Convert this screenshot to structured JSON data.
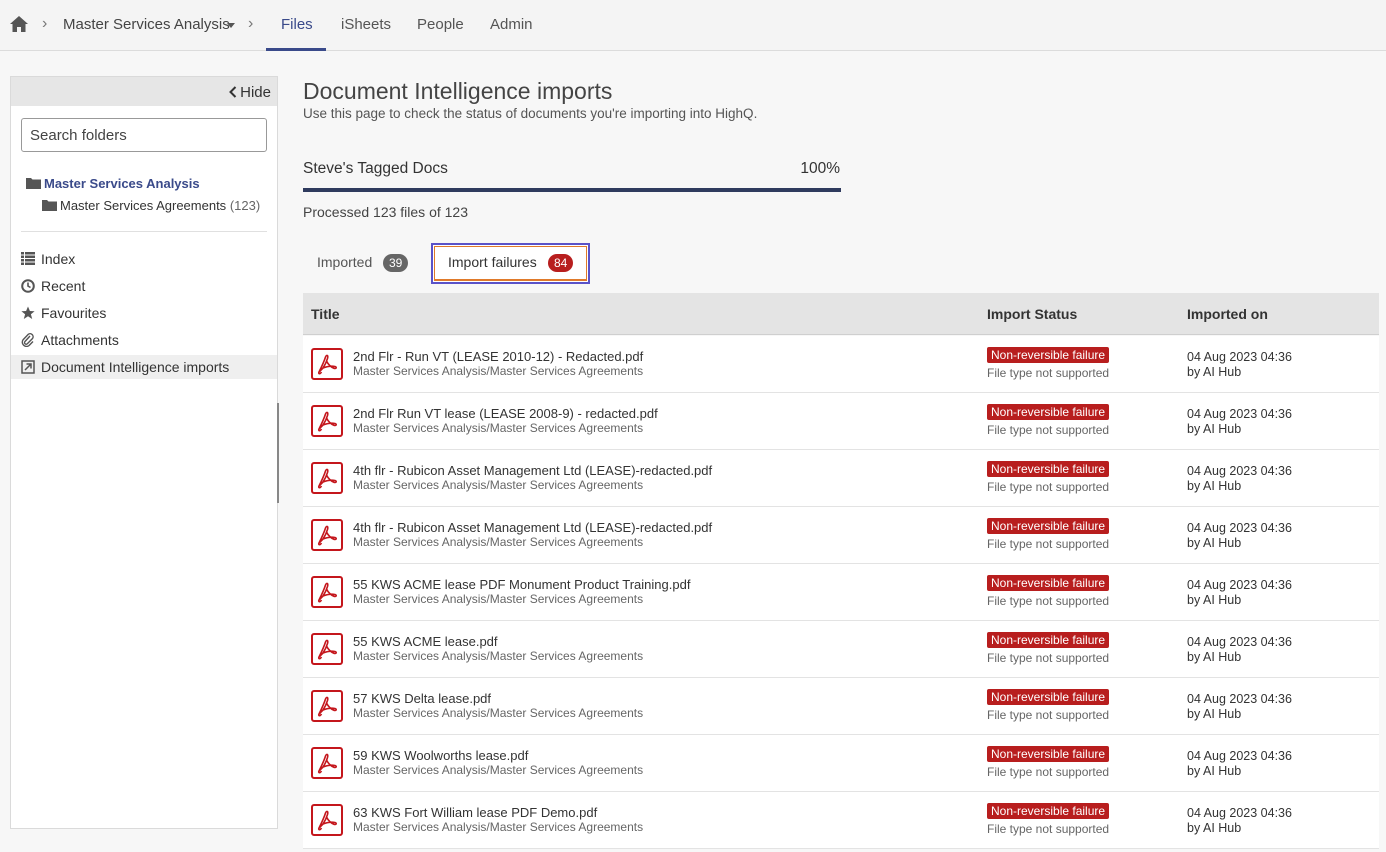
{
  "nav": {
    "breadcrumb": "Master Services Analysis",
    "tabs": [
      {
        "label": "Files",
        "active": true
      },
      {
        "label": "iSheets",
        "active": false
      },
      {
        "label": "People",
        "active": false
      },
      {
        "label": "Admin",
        "active": false
      }
    ],
    "accent": "#3a4a8a"
  },
  "sidebar": {
    "hide_label": "Hide",
    "search_placeholder": "Search folders",
    "folders": [
      {
        "label": "Master Services Analysis",
        "icon": "folder-icon"
      },
      {
        "label": "Master Services Agreements",
        "count": "(123)",
        "icon": "folder-icon"
      }
    ],
    "items": [
      {
        "label": "Index",
        "icon": "list-icon"
      },
      {
        "label": "Recent",
        "icon": "clock-icon"
      },
      {
        "label": "Favourites",
        "icon": "star-icon"
      },
      {
        "label": "Attachments",
        "icon": "paperclip-icon"
      },
      {
        "label": "Document Intelligence imports",
        "icon": "import-icon",
        "active": true
      }
    ]
  },
  "main": {
    "title": "Document Intelligence imports",
    "subtitle": "Use this page to check the status of documents you're importing into HighQ.",
    "job": {
      "name": "Steve's Tagged Docs",
      "percent_label": "100%",
      "progress": 1.0,
      "processed": "Processed 123 files of 123"
    },
    "filter_tabs": [
      {
        "label": "Imported",
        "count": "39"
      },
      {
        "label": "Import failures",
        "count": "84",
        "active": true
      }
    ],
    "table": {
      "headers": {
        "title": "Title",
        "status": "Import Status",
        "imported_on": "Imported on"
      },
      "rows": [
        {
          "title": "2nd Flr - Run VT (LEASE 2010-12) - Redacted.pdf",
          "path": "Master Services Analysis/Master Services Agreements",
          "status": "Non-reversible failure",
          "reason": "File type not supported",
          "date": "04 Aug 2023 04:36",
          "by": "by AI Hub"
        },
        {
          "title": "2nd Flr Run VT lease (LEASE 2008-9) - redacted.pdf",
          "path": "Master Services Analysis/Master Services Agreements",
          "status": "Non-reversible failure",
          "reason": "File type not supported",
          "date": "04 Aug 2023 04:36",
          "by": "by AI Hub"
        },
        {
          "title": "4th flr - Rubicon Asset Management Ltd (LEASE)-redacted.pdf",
          "path": "Master Services Analysis/Master Services Agreements",
          "status": "Non-reversible failure",
          "reason": "File type not supported",
          "date": "04 Aug 2023 04:36",
          "by": "by AI Hub"
        },
        {
          "title": "4th flr - Rubicon Asset Management Ltd (LEASE)-redacted.pdf",
          "path": "Master Services Analysis/Master Services Agreements",
          "status": "Non-reversible failure",
          "reason": "File type not supported",
          "date": "04 Aug 2023 04:36",
          "by": "by AI Hub"
        },
        {
          "title": "55 KWS ACME lease PDF Monument Product Training.pdf",
          "path": "Master Services Analysis/Master Services Agreements",
          "status": "Non-reversible failure",
          "reason": "File type not supported",
          "date": "04 Aug 2023 04:36",
          "by": "by AI Hub"
        },
        {
          "title": "55 KWS ACME lease.pdf",
          "path": "Master Services Analysis/Master Services Agreements",
          "status": "Non-reversible failure",
          "reason": "File type not supported",
          "date": "04 Aug 2023 04:36",
          "by": "by AI Hub"
        },
        {
          "title": "57 KWS Delta lease.pdf",
          "path": "Master Services Analysis/Master Services Agreements",
          "status": "Non-reversible failure",
          "reason": "File type not supported",
          "date": "04 Aug 2023 04:36",
          "by": "by AI Hub"
        },
        {
          "title": "59 KWS Woolworths lease.pdf",
          "path": "Master Services Analysis/Master Services Agreements",
          "status": "Non-reversible failure",
          "reason": "File type not supported",
          "date": "04 Aug 2023 04:36",
          "by": "by AI Hub"
        },
        {
          "title": "63 KWS Fort William lease PDF Demo.pdf",
          "path": "Master Services Analysis/Master Services Agreements",
          "status": "Non-reversible failure",
          "reason": "File type not supported",
          "date": "04 Aug 2023 04:36",
          "by": "by AI Hub"
        }
      ]
    },
    "colors": {
      "failure": "#b81e1e",
      "progress": "#2f3b5e",
      "pdf": "#c4161c"
    }
  }
}
